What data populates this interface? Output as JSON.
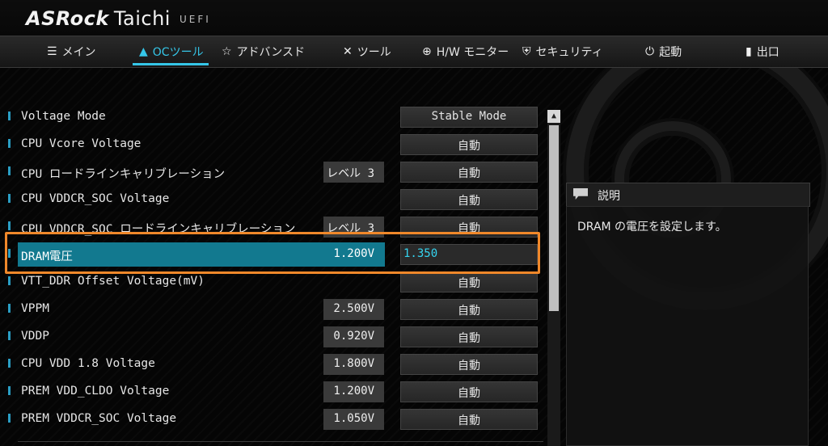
{
  "brand": {
    "logo_brand": "ASRock",
    "logo_model": "Taichi",
    "logo_sub": "UEFI"
  },
  "nav": {
    "tabs": [
      {
        "label": "メイン",
        "icon": "list-icon"
      },
      {
        "label": "OCツール",
        "icon": "rocket-icon",
        "active": true
      },
      {
        "label": "アドバンスド",
        "icon": "star-icon"
      },
      {
        "label": "ツール",
        "icon": "tools-icon"
      },
      {
        "label": "H/W モニター",
        "icon": "crosshair-icon"
      },
      {
        "label": "セキュリティ",
        "icon": "shield-icon"
      },
      {
        "label": "起動",
        "icon": "power-icon"
      },
      {
        "label": "出口",
        "icon": "exit-icon"
      }
    ]
  },
  "settings": [
    {
      "label": "Voltage Mode",
      "current": "",
      "value": "Stable Mode"
    },
    {
      "label": "CPU Vcore Voltage",
      "current": "",
      "value": "自動"
    },
    {
      "label": "CPU ロードラインキャリブレーション",
      "current": "レベル 3",
      "value": "自動"
    },
    {
      "label": "CPU VDDCR_SOC Voltage",
      "current": "",
      "value": "自動"
    },
    {
      "label": "CPU VDDCR_SOC ロードラインキャリブレーション",
      "current": "レベル 3",
      "value": "自動"
    },
    {
      "label": "DRAM電圧",
      "current": "1.200V",
      "value": "1.350",
      "selected": true
    },
    {
      "label": "VTT_DDR Offset Voltage(mV)",
      "current": "",
      "value": "自動"
    },
    {
      "label": "VPPM",
      "current": "2.500V",
      "value": "自動"
    },
    {
      "label": "VDDP",
      "current": "0.920V",
      "value": "自動"
    },
    {
      "label": "CPU VDD 1.8 Voltage",
      "current": "1.800V",
      "value": "自動"
    },
    {
      "label": "PREM VDD_CLDO Voltage",
      "current": "1.200V",
      "value": "自動"
    },
    {
      "label": "PREM VDDCR_SOC Voltage",
      "current": "1.050V",
      "value": "自動"
    }
  ],
  "help": {
    "title": "説明",
    "text": "DRAM の電圧を設定します。"
  },
  "colors": {
    "accent": "#35c6e8",
    "selected_row": "#12798f",
    "highlight_box": "#f0882a"
  }
}
